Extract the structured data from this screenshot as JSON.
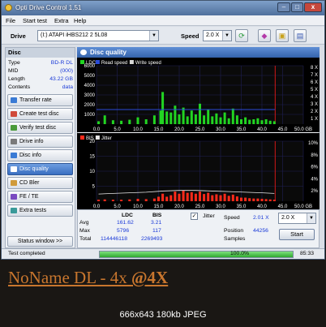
{
  "window": {
    "title": "Opti Drive Control 1.51",
    "menu": [
      "File",
      "Start test",
      "Extra",
      "Help"
    ]
  },
  "drivebar": {
    "drive_label": "Drive",
    "drive_value": "(I:)  ATAPI iHBS212   2 5L08",
    "speed_label": "Speed",
    "speed_value": "2.0 X",
    "icons": [
      "refresh-icon",
      "eraser-icon",
      "chip-icon",
      "save-icon"
    ]
  },
  "disc": {
    "header": "Disc",
    "rows": [
      {
        "k": "Type",
        "v": "BD-R DL"
      },
      {
        "k": "MID",
        "v": "(000)"
      },
      {
        "k": "Length",
        "v": "43.22 GB"
      },
      {
        "k": "Contents",
        "v": "data"
      }
    ]
  },
  "nav": [
    {
      "label": "Transfer rate",
      "icon": "transfer-icon",
      "color": "#3a7bd5"
    },
    {
      "label": "Create test disc",
      "icon": "disc-create-icon",
      "color": "#d04a3a"
    },
    {
      "label": "Verify test disc",
      "icon": "verify-icon",
      "color": "#4a9a3a"
    },
    {
      "label": "Drive info",
      "icon": "drive-icon",
      "color": "#7a7a7a"
    },
    {
      "label": "Disc info",
      "icon": "disc-info-icon",
      "color": "#3a7bd5"
    },
    {
      "label": "Disc quality",
      "icon": "quality-icon",
      "color": "#ffffff"
    },
    {
      "label": "CD Bler",
      "icon": "cd-icon",
      "color": "#d09a3a"
    },
    {
      "label": "FE / TE",
      "icon": "fete-icon",
      "color": "#7a4ac0"
    },
    {
      "label": "Extra tests",
      "icon": "extra-icon",
      "color": "#3a9a9a"
    }
  ],
  "status_window_btn": "Status window >>",
  "panel_title": "Disc quality",
  "chart_data": [
    {
      "type": "area",
      "legend": [
        "LDC",
        "Read speed",
        "Write speed"
      ],
      "x_ticks": [
        "0.0",
        "5.0",
        "10.0",
        "15.0",
        "20.0",
        "25.0",
        "30.0",
        "35.0",
        "40.0",
        "45.0",
        "50.0 GB"
      ],
      "y_left_ticks": [
        "6000",
        "5000",
        "4000",
        "3000",
        "2000",
        "1000"
      ],
      "y_right_ticks": [
        "8 X",
        "7 X",
        "6 X",
        "5 X",
        "4 X",
        "3 X",
        "2 X",
        "1 X"
      ],
      "xlim": [
        0,
        50
      ],
      "ylim": [
        0,
        6000
      ],
      "data_end": 43.2,
      "series": [
        {
          "name": "LDC",
          "color": "#22d522",
          "x": [
            0.5,
            2,
            4,
            6,
            8,
            10,
            12,
            14,
            15.5,
            16,
            17,
            18,
            19,
            20,
            21,
            22,
            23,
            24,
            25,
            26,
            27,
            28,
            29,
            30,
            31,
            32,
            33,
            34,
            35,
            36,
            37,
            38,
            39,
            40,
            41,
            42,
            43
          ],
          "values": [
            300,
            900,
            400,
            350,
            450,
            700,
            500,
            900,
            1400,
            3300,
            1300,
            1200,
            1900,
            1000,
            1700,
            800,
            1400,
            1000,
            2100,
            900,
            1500,
            800,
            1100,
            700,
            1200,
            600,
            1600,
            900,
            500,
            700,
            450,
            500,
            600,
            400,
            500,
            350,
            300
          ]
        },
        {
          "name": "Read speed",
          "color": "#2a4bd8",
          "x": [
            0,
            43.2
          ],
          "values": [
            2.0,
            2.0
          ]
        }
      ]
    },
    {
      "type": "area",
      "legend": [
        "BIS",
        "Jitter"
      ],
      "x_ticks": [
        "0.0",
        "5.0",
        "10.0",
        "15.0",
        "20.0",
        "25.0",
        "30.0",
        "35.0",
        "40.0",
        "45.0",
        "50.0 GB"
      ],
      "y_left_ticks": [
        "20",
        "15",
        "10",
        "5"
      ],
      "y_right_ticks": [
        "10%",
        "8%",
        "6%",
        "4%",
        "2%"
      ],
      "xlim": [
        0,
        50
      ],
      "ylim": [
        0,
        20
      ],
      "data_end": 43.2,
      "series": [
        {
          "name": "BIS",
          "color": "#ff2a1a",
          "x": [
            0.5,
            2,
            4,
            6,
            8,
            10,
            12,
            14,
            15,
            16,
            17,
            18,
            19,
            20,
            21,
            22,
            23,
            24,
            25,
            26,
            27,
            28,
            29,
            30,
            31,
            32,
            33,
            34,
            35,
            36,
            37,
            38,
            39,
            40,
            41,
            42,
            43
          ],
          "values": [
            0.5,
            0.6,
            0.5,
            0.5,
            0.6,
            0.8,
            0.7,
            0.9,
            1.5,
            2.5,
            1.5,
            2,
            3.2,
            2.5,
            3.5,
            2.8,
            3,
            2.5,
            3.2,
            2.4,
            2.8,
            2,
            2.3,
            2,
            2.5,
            1.8,
            2.2,
            1.6,
            1.2,
            1.2,
            1,
            0.9,
            0.9,
            0.8,
            0.7,
            0.6,
            0.5
          ]
        },
        {
          "name": "Jitter",
          "color": "#e8e8e8",
          "x": [
            0.5,
            4,
            8,
            12,
            16,
            20,
            24,
            28,
            32,
            36,
            40,
            43
          ],
          "values": [
            1.2,
            1.3,
            1.4,
            1.5,
            1.7,
            1.8,
            1.8,
            1.7,
            1.6,
            1.5,
            1.4,
            1.3
          ]
        }
      ]
    }
  ],
  "stats": {
    "col_ldc": "LDC",
    "col_bis": "BIS",
    "rows": [
      {
        "label": "Avg",
        "ldc": "161.62",
        "bis": "3.21"
      },
      {
        "label": "Max",
        "ldc": "5796",
        "bis": "117"
      },
      {
        "label": "Total",
        "ldc": "114446118",
        "bis": "2269493"
      }
    ],
    "jitter_label": "Jitter",
    "jitter_checked": "✓",
    "speed_label": "Speed",
    "speed_value": "2.01 X",
    "speed_select": "2.0 X",
    "position_label": "Position",
    "position_value": "44256",
    "samples_label": "Samples",
    "start_label": "Start"
  },
  "statusbar": {
    "text": "Test completed",
    "progress_pct": "100.0%",
    "progress_fraction": 1.0,
    "elapsed": "85:33"
  },
  "caption": {
    "prefix": "NoName DL - 4x ",
    "suffix": "@4X"
  },
  "image_info": "666x643 180kb JPEG"
}
